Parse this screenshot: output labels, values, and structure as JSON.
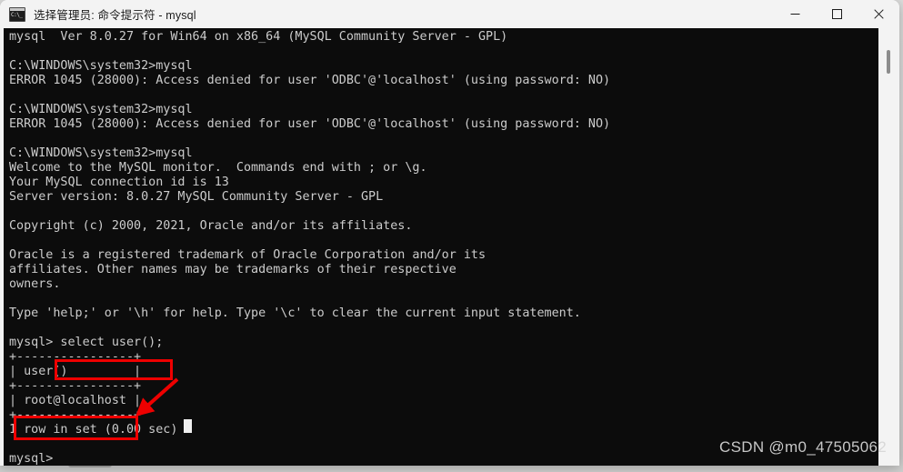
{
  "window": {
    "title": "选择管理员: 命令提示符 - mysql",
    "icon": "cmd-console-icon",
    "controls": {
      "minimize_label": "—",
      "maximize_label": "□",
      "close_label": "✕"
    }
  },
  "terminal": {
    "lines": [
      "mysql  Ver 8.0.27 for Win64 on x86_64 (MySQL Community Server - GPL)",
      "",
      "C:\\WINDOWS\\system32>mysql",
      "ERROR 1045 (28000): Access denied for user 'ODBC'@'localhost' (using password: NO)",
      "",
      "C:\\WINDOWS\\system32>mysql",
      "ERROR 1045 (28000): Access denied for user 'ODBC'@'localhost' (using password: NO)",
      "",
      "C:\\WINDOWS\\system32>mysql",
      "Welcome to the MySQL monitor.  Commands end with ; or \\g.",
      "Your MySQL connection id is 13",
      "Server version: 8.0.27 MySQL Community Server - GPL",
      "",
      "Copyright (c) 2000, 2021, Oracle and/or its affiliates.",
      "",
      "Oracle is a registered trademark of Oracle Corporation and/or its",
      "affiliates. Other names may be trademarks of their respective",
      "owners.",
      "",
      "Type 'help;' or '\\h' for help. Type '\\c' to clear the current input statement.",
      "",
      "mysql> select user();",
      "+----------------+",
      "| user()         |",
      "+----------------+",
      "| root@localhost |",
      "+----------------+",
      "1 row in set (0.00 sec)",
      "",
      "mysql>"
    ],
    "prompt": "mysql>",
    "executed_command": "select user();",
    "query_result_value": "root@localhost",
    "result_column_header": "user()",
    "result_status": "1 row in set (0.00 sec)",
    "server_version": "8.0.27",
    "connection_id": "13",
    "colors": {
      "background": "#0c0c0c",
      "foreground": "#cccccc",
      "annotation": "#ee0000"
    }
  },
  "annotations": {
    "query_highlight_label": "select user();",
    "result_highlight_label": "root@localhost",
    "arrow_label": "arrow-from-query-to-result"
  },
  "scrollbar": {
    "orientation": "vertical",
    "position": "top"
  },
  "watermark": {
    "text": "CSDN @m0_47505062"
  }
}
